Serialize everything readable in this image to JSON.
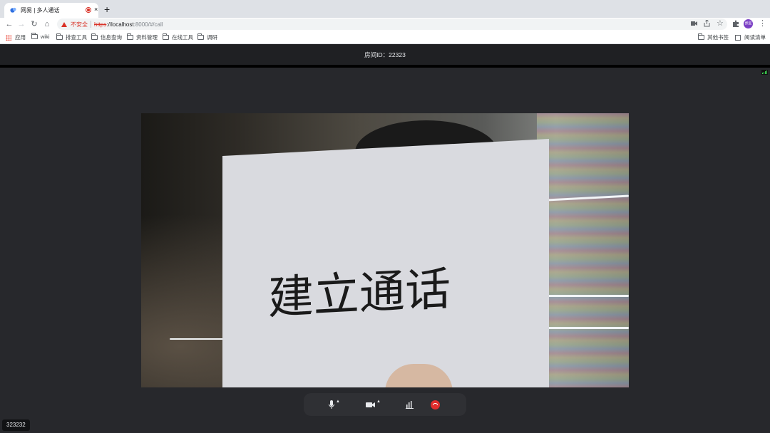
{
  "browser": {
    "tab_title": "网易 | 多人通话",
    "tab_close": "×",
    "new_tab": "+",
    "security_label": "不安全",
    "url": {
      "scheme": "https",
      "host": "://localhost",
      "path": ":8000/#/call"
    },
    "avatar_text": "张星"
  },
  "bookmarks": {
    "apps": "应用",
    "items": [
      "wiki",
      "排查工具",
      "信息查询",
      "资料管理",
      "在线工具",
      "调研"
    ],
    "other": "其他书签",
    "reading_list": "阅读清单"
  },
  "call": {
    "room_id": "房间ID：22323",
    "user_id": "323232",
    "paper_text": "建立通话",
    "controls": [
      "microphone",
      "camera",
      "stats",
      "hang-up"
    ]
  },
  "colors": {
    "accent_red": "#e02d2d",
    "header_bg": "#1f2023",
    "stage_bg": "#27282c"
  }
}
